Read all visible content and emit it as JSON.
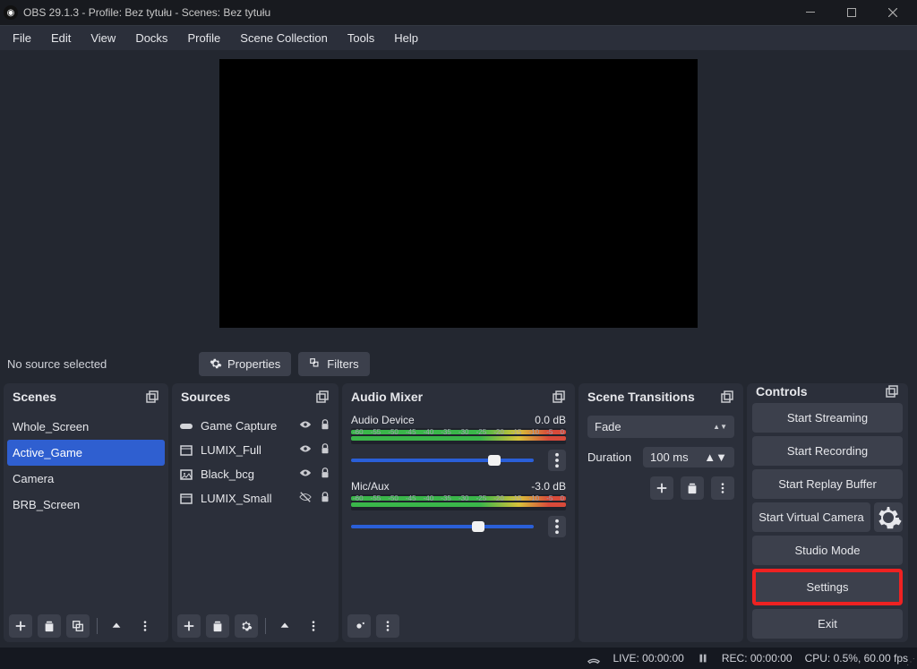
{
  "title": "OBS 29.1.3 - Profile: Bez tytułu - Scenes: Bez tytułu",
  "menu": {
    "file": "File",
    "edit": "Edit",
    "view": "View",
    "docks": "Docks",
    "profile": "Profile",
    "scene": "Scene Collection",
    "tools": "Tools",
    "help": "Help"
  },
  "no_source": "No source selected",
  "properties": "Properties",
  "filters": "Filters",
  "panels": {
    "scenes": "Scenes",
    "sources": "Sources",
    "mixer": "Audio Mixer",
    "trans": "Scene Transitions",
    "controls": "Controls"
  },
  "scenes": {
    "items": [
      {
        "label": "Whole_Screen"
      },
      {
        "label": "Active_Game"
      },
      {
        "label": "Camera"
      },
      {
        "label": "BRB_Screen"
      }
    ],
    "selected": 1
  },
  "sources": {
    "items": [
      {
        "icon": "gamepad",
        "label": "Game Capture",
        "vis": true,
        "lock": true
      },
      {
        "icon": "window",
        "label": "LUMIX_Full",
        "vis": true,
        "lock": true
      },
      {
        "icon": "image",
        "label": "Black_bcg",
        "vis": true,
        "lock": true
      },
      {
        "icon": "window",
        "label": "LUMIX_Small",
        "vis": false,
        "lock": true
      }
    ]
  },
  "mixer": {
    "ch": [
      {
        "name": "Audio Device",
        "db": "0.0 dB",
        "vol": 75,
        "muted": true,
        "ticks": [
          "-60",
          "-55",
          "-50",
          "-45",
          "-40",
          "-35",
          "-30",
          "-25",
          "-20",
          "-15",
          "-10",
          "-5",
          "0"
        ]
      },
      {
        "name": "Mic/Aux",
        "db": "-3.0 dB",
        "vol": 66,
        "muted": false,
        "ticks": [
          "-60",
          "-55",
          "-50",
          "-45",
          "-40",
          "-35",
          "-30",
          "-25",
          "-20",
          "-15",
          "-10",
          "-5",
          "0"
        ]
      }
    ]
  },
  "trans": {
    "current": "Fade",
    "dur_label": "Duration",
    "dur_val": "100 ms"
  },
  "controls": {
    "stream": "Start Streaming",
    "rec": "Start Recording",
    "replay": "Start Replay Buffer",
    "vcam": "Start Virtual Camera",
    "studio": "Studio Mode",
    "settings": "Settings",
    "exit": "Exit"
  },
  "status": {
    "live_lbl": "LIVE:",
    "live": "00:00:00",
    "rec_lbl": "REC:",
    "rec": "00:00:00",
    "cpu": "CPU: 0.5%, 60.00 fps"
  }
}
